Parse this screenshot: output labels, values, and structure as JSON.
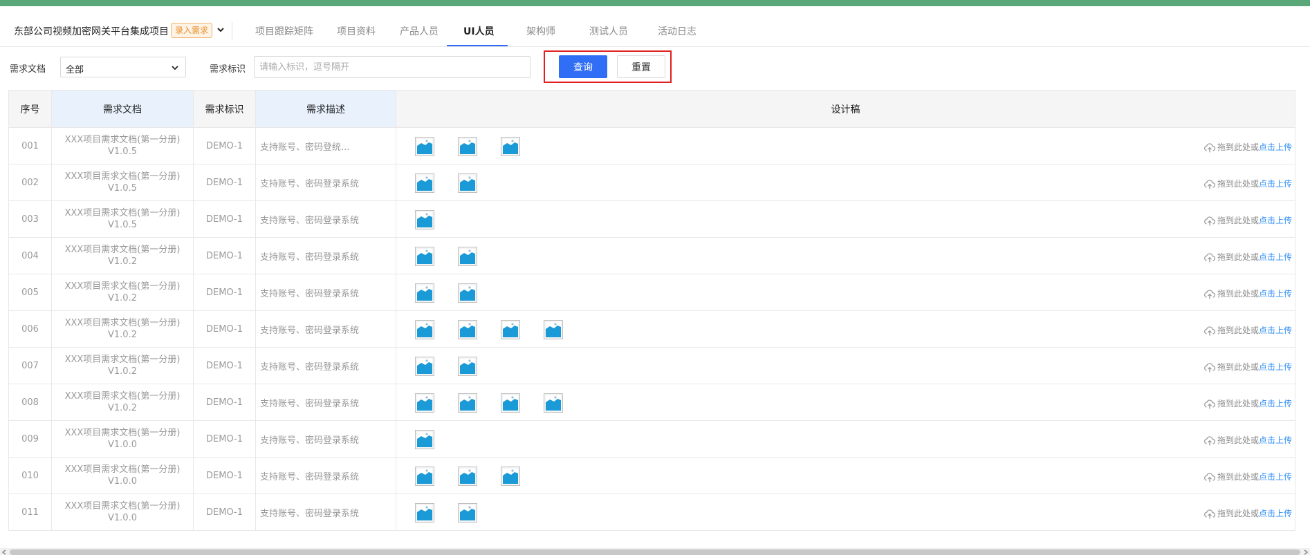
{
  "header": {
    "project_title": "东部公司视频加密网关平台集成项目",
    "project_badge": "录入需求",
    "tabs": [
      {
        "label": "项目跟踪矩阵",
        "active": false
      },
      {
        "label": "项目资料",
        "active": false
      },
      {
        "label": "产品人员",
        "active": false
      },
      {
        "label": "UI人员",
        "active": true
      },
      {
        "label": "架构师",
        "active": false
      },
      {
        "label": "测试人员",
        "active": false
      },
      {
        "label": "活动日志",
        "active": false
      }
    ]
  },
  "filters": {
    "doc_label": "需求文档",
    "doc_value": "全部",
    "id_label": "需求标识",
    "id_placeholder": "请输入标识，逗号隔开",
    "query_button": "查询",
    "reset_button": "重置"
  },
  "table": {
    "headers": [
      "序号",
      "需求文档",
      "需求标识",
      "需求描述",
      "设计稿"
    ],
    "upload_text": "拖到此处或",
    "upload_link": "点击上传",
    "rows": [
      {
        "no": "001",
        "doc_line1": "XXX项目需求文档(第一分册)",
        "doc_line2": "V1.0.5",
        "id": "DEMO-1",
        "desc": "支持账号、密码登统...",
        "images": 3
      },
      {
        "no": "002",
        "doc_line1": "XXX项目需求文档(第一分册)",
        "doc_line2": "V1.0.5",
        "id": "DEMO-1",
        "desc": "支持账号、密码登录系统",
        "images": 2
      },
      {
        "no": "003",
        "doc_line1": "XXX项目需求文档(第一分册)",
        "doc_line2": "V1.0.5",
        "id": "DEMO-1",
        "desc": "支持账号、密码登录系统",
        "images": 1
      },
      {
        "no": "004",
        "doc_line1": "XXX项目需求文档(第一分册)",
        "doc_line2": "V1.0.2",
        "id": "DEMO-1",
        "desc": "支持账号、密码登录系统",
        "images": 2
      },
      {
        "no": "005",
        "doc_line1": "XXX项目需求文档(第一分册)",
        "doc_line2": "V1.0.2",
        "id": "DEMO-1",
        "desc": "支持账号、密码登录系统",
        "images": 2
      },
      {
        "no": "006",
        "doc_line1": "XXX项目需求文档(第一分册)",
        "doc_line2": "V1.0.2",
        "id": "DEMO-1",
        "desc": "支持账号、密码登录系统",
        "images": 4
      },
      {
        "no": "007",
        "doc_line1": "XXX项目需求文档(第一分册)",
        "doc_line2": "V1.0.2",
        "id": "DEMO-1",
        "desc": "支持账号、密码登录系统",
        "images": 2
      },
      {
        "no": "008",
        "doc_line1": "XXX项目需求文档(第一分册)",
        "doc_line2": "V1.0.2",
        "id": "DEMO-1",
        "desc": "支持账号、密码登录系统",
        "images": 4
      },
      {
        "no": "009",
        "doc_line1": "XXX项目需求文档(第一分册)",
        "doc_line2": "V1.0.0",
        "id": "DEMO-1",
        "desc": "支持账号、密码登录系统",
        "images": 1
      },
      {
        "no": "010",
        "doc_line1": "XXX项目需求文档(第一分册)",
        "doc_line2": "V1.0.0",
        "id": "DEMO-1",
        "desc": "支持账号、密码登录系统",
        "images": 3
      },
      {
        "no": "011",
        "doc_line1": "XXX项目需求文档(第一分册)",
        "doc_line2": "V1.0.0",
        "id": "DEMO-1",
        "desc": "支持账号、密码登录系统",
        "images": 2
      }
    ]
  },
  "icons": {
    "thumbnail": "image-thumbnail-icon",
    "upload": "cloud-upload-icon",
    "chevron": "chevron-down-icon"
  },
  "colors": {
    "top_bar": "#5aa87a",
    "accent": "#2f6ef5",
    "badge": "#e8912c",
    "highlight_border": "#e02020",
    "thumbnail_blue": "#1a9ad6"
  }
}
